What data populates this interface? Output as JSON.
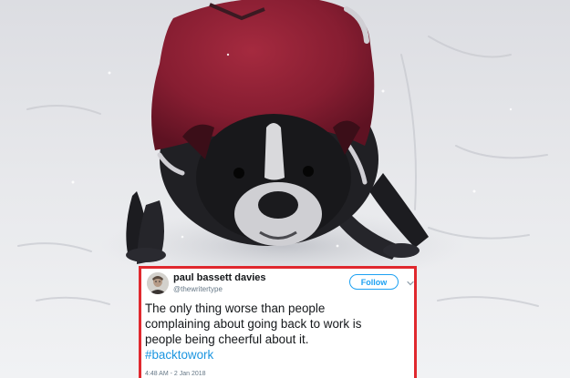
{
  "tweet": {
    "display_name": "paul bassett davies",
    "handle": "@thewritertype",
    "follow_label": "Follow",
    "text_lines": [
      "The only thing worse than people",
      "complaining about going back to work is",
      "people being cheerful about it."
    ],
    "hashtag": "#backtowork",
    "timestamp": "4:48 AM - 2 Jan 2018"
  },
  "colors": {
    "highlight_border": "#e0282e",
    "twitter_blue": "#1da1f2",
    "hashtag_blue": "#1b95e0",
    "dog_coat": "#8e1f33",
    "snow": "#eeeff1"
  },
  "icons": {
    "menu": "chevron-down-icon"
  }
}
